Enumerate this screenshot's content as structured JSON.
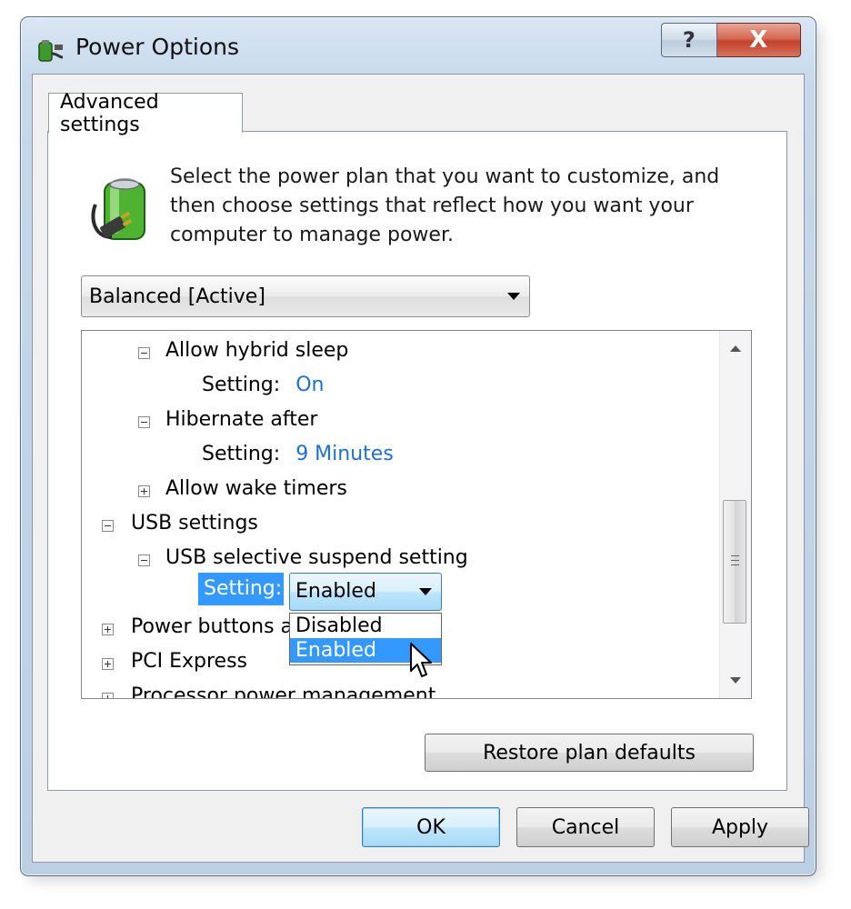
{
  "window": {
    "title": "Power Options",
    "help_glyph": "?",
    "close_glyph": "X"
  },
  "tab": {
    "label": "Advanced settings"
  },
  "intro_text": "Select the power plan that you want to customize, and then choose settings that reflect how you want your computer to manage power.",
  "plan_select": {
    "value": "Balanced [Active]"
  },
  "tree": {
    "allow_hybrid_sleep": {
      "label": "Allow hybrid sleep",
      "setting_label": "Setting:",
      "setting_value": "On"
    },
    "hibernate_after": {
      "label": "Hibernate after",
      "setting_label": "Setting:",
      "setting_value": "9 Minutes"
    },
    "allow_wake_timers": {
      "label": "Allow wake timers"
    },
    "usb_settings": {
      "label": "USB settings"
    },
    "usb_selective": {
      "label": "USB selective suspend setting",
      "setting_label": "Setting:"
    },
    "power_buttons": {
      "label": "Power buttons and lid"
    },
    "pci_express": {
      "label": "PCI Express"
    },
    "processor": {
      "label": "Processor power management"
    }
  },
  "usb_combo": {
    "value": "Enabled",
    "options": [
      "Disabled",
      "Enabled"
    ],
    "highlighted": "Enabled"
  },
  "buttons": {
    "restore": "Restore plan defaults",
    "ok": "OK",
    "cancel": "Cancel",
    "apply": "Apply"
  },
  "icons": {
    "title": "power-options-icon",
    "battery": "battery-plug-icon",
    "cursor": "mouse-pointer-icon"
  }
}
